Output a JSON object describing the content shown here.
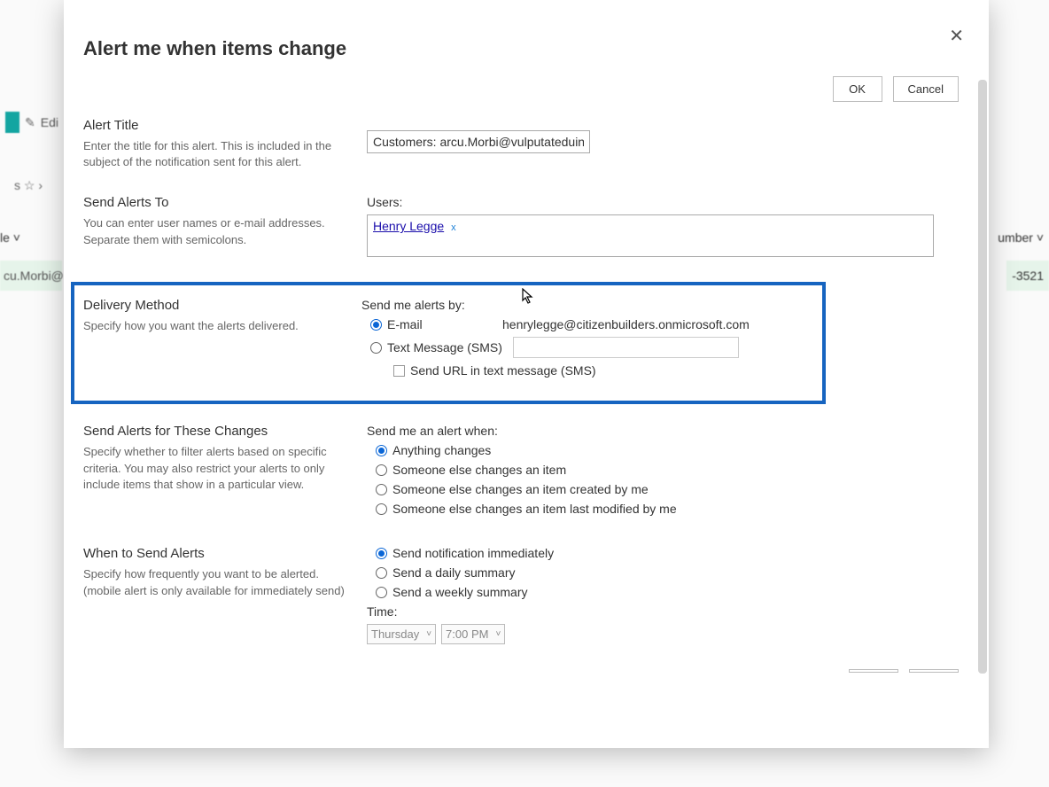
{
  "bg": {
    "edit_label": "Edi",
    "star_row": "s ☆ ›",
    "dropdown": "le  ˅",
    "row_text": "cu.Morbi@",
    "right_header": "umber  ˅",
    "right_cell": "-3521"
  },
  "dialog": {
    "title": "Alert me when items change",
    "ok": "OK",
    "cancel": "Cancel"
  },
  "alert_title": {
    "heading": "Alert Title",
    "desc": "Enter the title for this alert. This is included in the subject of the notification sent for this alert.",
    "value": "Customers: arcu.Morbi@vulputateduinec."
  },
  "send_to": {
    "heading": "Send Alerts To",
    "desc": "You can enter user names or e-mail addresses. Separate them with semicolons.",
    "label": "Users:",
    "person": "Henry Legge",
    "remove": "x"
  },
  "delivery": {
    "heading": "Delivery Method",
    "desc": "Specify how you want the alerts delivered.",
    "label": "Send me alerts by:",
    "email_opt": "E-mail",
    "email_value": "henrylegge@citizenbuilders.onmicrosoft.com",
    "sms_opt": "Text Message (SMS)",
    "sms_url_opt": "Send URL in text message (SMS)"
  },
  "changes": {
    "heading": "Send Alerts for These Changes",
    "desc": "Specify whether to filter alerts based on specific criteria. You may also restrict your alerts to only include items that show in a particular view.",
    "label": "Send me an alert when:",
    "opt1": "Anything changes",
    "opt2": "Someone else changes an item",
    "opt3": "Someone else changes an item created by me",
    "opt4": "Someone else changes an item last modified by me"
  },
  "when": {
    "heading": "When to Send Alerts",
    "desc": "Specify how frequently you want to be alerted. (mobile alert is only available for immediately send)",
    "opt1": "Send notification immediately",
    "opt2": "Send a daily summary",
    "opt3": "Send a weekly summary",
    "time_label": "Time:",
    "day": "Thursday",
    "hour": "7:00 PM"
  }
}
